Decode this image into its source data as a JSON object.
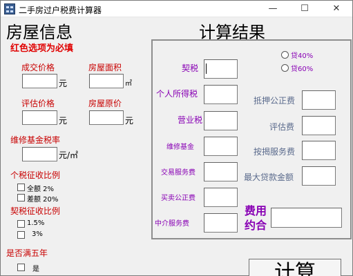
{
  "window": {
    "title": "二手房过户税费计算器",
    "min_glyph": "—",
    "max_glyph": "☐",
    "close_glyph": "✕"
  },
  "left": {
    "heading": "房屋信息",
    "required_note": "红色选项为必填",
    "deal_price_label": "成交价格",
    "deal_price_unit": "元",
    "area_label": "房屋面积",
    "area_unit": "㎡",
    "eval_price_label": "评估价格",
    "eval_price_unit": "元",
    "orig_price_label": "房屋原价",
    "orig_price_unit": "元",
    "maint_rate_label": "维修基金税率",
    "maint_rate_unit": "元/㎡",
    "tax_ratio_label": "个税征收比例",
    "tax_full_label": "全额  2%",
    "tax_diff_label": "差额 20%",
    "deed_ratio_label": "契税征收比例",
    "deed_15_label": "1.5%",
    "deed_3_label": "3%",
    "five_years_label": "是否满五年",
    "five_years_yes": "是"
  },
  "right": {
    "heading": "计算结果",
    "deed_tax_label": "契税",
    "income_tax_label": "个人所得税",
    "business_tax_label": "营业税",
    "maint_fund_label": "维修基金",
    "trade_fee_label": "交易服务费",
    "notary_fee_label": "买卖公正费",
    "agency_fee_label": "中介服务费",
    "loan40_label": "贷40%",
    "loan60_label": "贷60%",
    "mortgage_notary_label": "抵押公正费",
    "eval_fee_label": "评估费",
    "mortgage_service_label": "按揭服务费",
    "max_loan_label": "最大贷款金额",
    "total_fee_label_1": "费用",
    "total_fee_label_2": "约合"
  },
  "buttons": {
    "calculate": "计算"
  }
}
